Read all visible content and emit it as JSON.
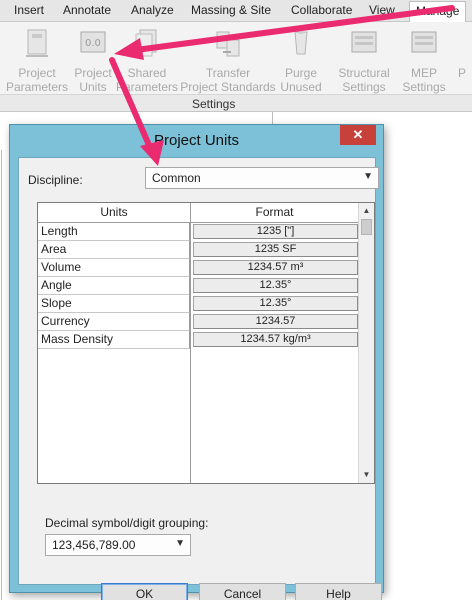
{
  "ribbon": {
    "tabs": [
      {
        "label": "Insert"
      },
      {
        "label": "Annotate"
      },
      {
        "label": "Analyze"
      },
      {
        "label": "Massing & Site"
      },
      {
        "label": "Collaborate"
      },
      {
        "label": "View"
      },
      {
        "label": "Manage",
        "active": true
      }
    ],
    "buttons": [
      {
        "line1": "Project",
        "line2": "Parameters",
        "icon": "project-parameters-icon"
      },
      {
        "line1": "Project",
        "line2": "Units",
        "icon": "project-units-icon"
      },
      {
        "line1": "Shared",
        "line2": "Parameters",
        "icon": "shared-parameters-icon"
      },
      {
        "line1": "Transfer",
        "line2": "Project Standards",
        "icon": "transfer-standards-icon"
      },
      {
        "line1": "Purge",
        "line2": "Unused",
        "icon": "purge-unused-icon"
      },
      {
        "line1": "Structural",
        "line2": "Settings",
        "icon": "structural-settings-icon"
      },
      {
        "line1": "MEP",
        "line2": "Settings",
        "icon": "mep-settings-icon"
      },
      {
        "line1": "P",
        "line2": "",
        "icon": "truncated-icon"
      }
    ],
    "group_label": "Settings"
  },
  "dialog": {
    "title": "Project Units",
    "close_glyph": "✕",
    "discipline_label": "Discipline:",
    "discipline_value": "Common",
    "table": {
      "headers": [
        "Units",
        "Format"
      ],
      "rows": [
        {
          "unit": "Length",
          "format": "1235 [\"]"
        },
        {
          "unit": "Area",
          "format": "1235 SF"
        },
        {
          "unit": "Volume",
          "format": "1234.57 m³"
        },
        {
          "unit": "Angle",
          "format": "12.35°"
        },
        {
          "unit": "Slope",
          "format": "12.35°"
        },
        {
          "unit": "Currency",
          "format": "1234.57"
        },
        {
          "unit": "Mass Density",
          "format": "1234.57 kg/m³"
        }
      ]
    },
    "decimal_label": "Decimal symbol/digit grouping:",
    "decimal_value": "123,456,789.00",
    "buttons": {
      "ok": "OK",
      "cancel": "Cancel",
      "help": "Help"
    }
  },
  "colors": {
    "dialog_frame": "#7dc1d8",
    "close_button": "#c7413a",
    "annotation_arrow": "#ea2b6f"
  }
}
